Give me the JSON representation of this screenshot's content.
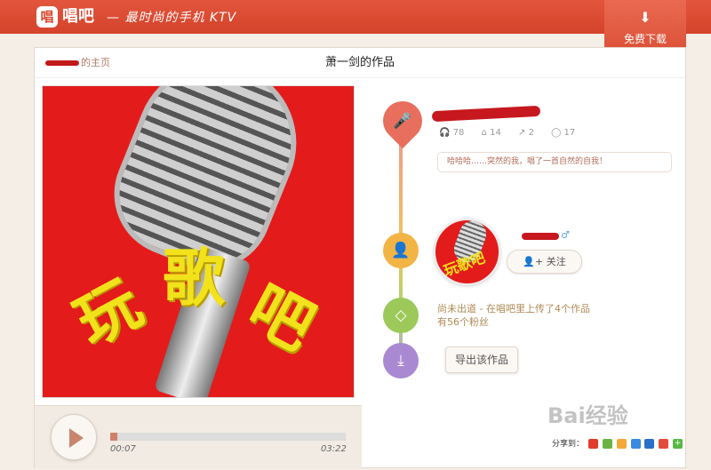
{
  "header": {
    "logo_char": "唱",
    "brand": "唱吧",
    "slogan": "— 最时尚的手机 KTV",
    "download_label": "免费下载",
    "download_icon": "download-icon"
  },
  "page": {
    "home_link": "的主页",
    "title": "萧一剑的作品"
  },
  "cover": {
    "text_1": "玩",
    "text_2": "歌",
    "text_3": "吧"
  },
  "player": {
    "current_time": "00:07",
    "total_time": "03:22",
    "progress_percent": 3
  },
  "song": {
    "stats": {
      "listens": "78",
      "flowers": "14",
      "shares": "2",
      "comments": "17"
    },
    "description": "哈哈哈……突然的我，唱了一首自然的自我！"
  },
  "user": {
    "follow_label": "关注",
    "avatar_text": "玩歌吧",
    "gender_symbol": "♂",
    "rank_line_1": "尚未出道 - 在唱吧里上传了4个作品",
    "rank_line_2": "有56个粉丝"
  },
  "actions": {
    "export_label": "导出该作品"
  },
  "share": {
    "label": "分享到："
  },
  "watermark": "Bai经验",
  "colors": {
    "brand_red": "#d4432b",
    "accent": "#d1806a",
    "node_song": "#e86e5e",
    "node_user": "#f2b445",
    "node_rank": "#9cc95a",
    "node_export": "#a98ad2"
  }
}
